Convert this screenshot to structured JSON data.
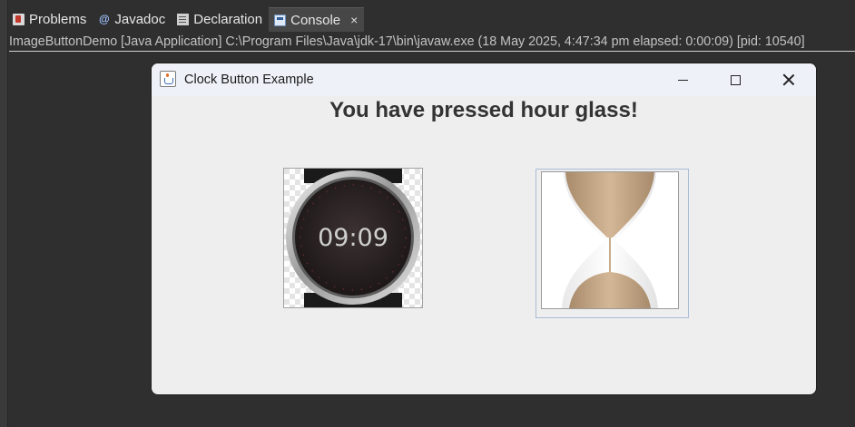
{
  "tabs": [
    {
      "label": "Problems",
      "icon": "problems-icon"
    },
    {
      "label": "Javadoc",
      "icon": "javadoc-icon"
    },
    {
      "label": "Declaration",
      "icon": "declaration-icon"
    },
    {
      "label": "Console",
      "icon": "console-icon",
      "active": true,
      "close": "×"
    }
  ],
  "console": {
    "info": "ImageButtonDemo [Java Application] C:\\Program Files\\Java\\jdk-17\\bin\\javaw.exe  (18 May 2025, 4:47:34 pm elapsed: 0:00:09) [pid: 10540]"
  },
  "window": {
    "title": "Clock Button Example",
    "message": "You have pressed hour glass!",
    "clock_display": "09:09"
  },
  "colors": {
    "ide_background": "#2f2f2f",
    "window_background": "#eeeeee",
    "titlebar": "#eef2f8",
    "sand": "#c9ac8a"
  }
}
